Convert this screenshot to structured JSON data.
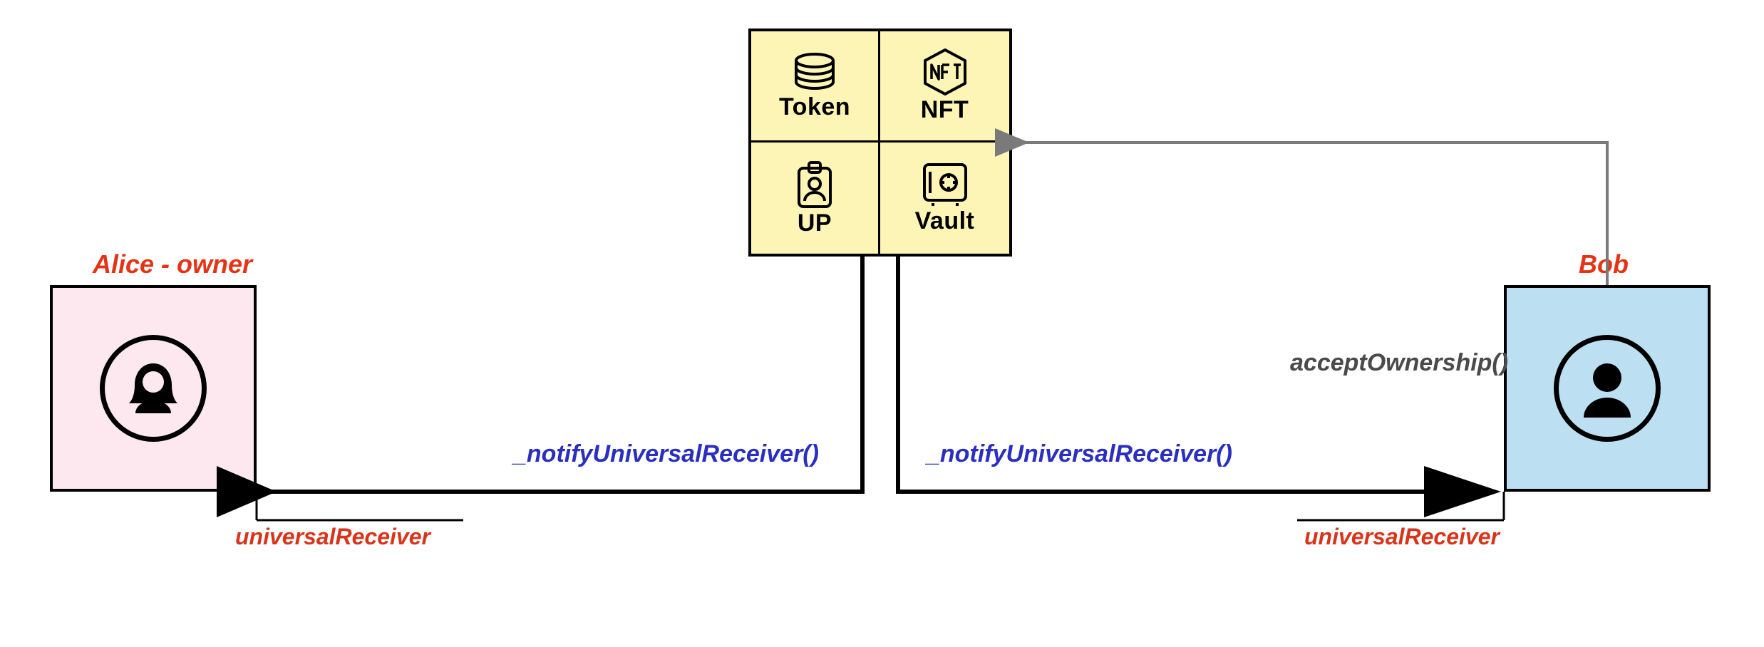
{
  "actors": {
    "alice": {
      "title": "Alice - owner",
      "receiver_label": "universalReceiver"
    },
    "bob": {
      "title": "Bob",
      "receiver_label": "universalReceiver"
    }
  },
  "asset_grid": {
    "token": "Token",
    "nft": "NFT",
    "up": "UP",
    "vault": "Vault"
  },
  "calls": {
    "notify_left": "_notifyUniversalReceiver()",
    "notify_right": "_notifyUniversalReceiver()",
    "accept": "acceptOwnership()"
  },
  "colors": {
    "alice_bg": "#fce8ee",
    "bob_bg": "#bcdff1",
    "asset_bg": "#fdf5b6",
    "accent_red": "#e43416",
    "accent_blue": "#2a2fbf",
    "accent_gray": "#7a7a7a"
  }
}
